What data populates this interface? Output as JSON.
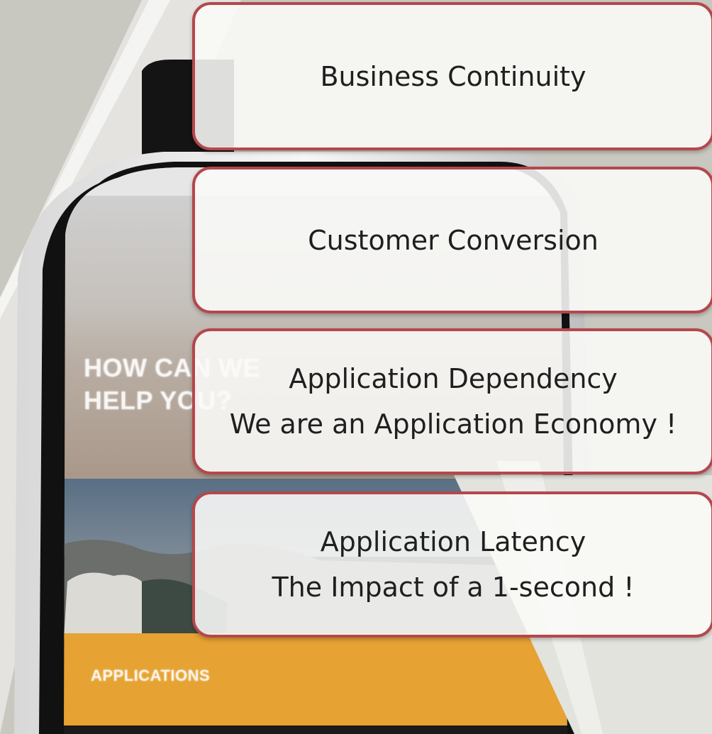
{
  "phone": {
    "headline": "HOW CAN WE\nHELP YOU?",
    "section_label": "APPLICATIONS"
  },
  "callouts": [
    {
      "line1": "Business Continuity",
      "line2": ""
    },
    {
      "line1": "Customer Conversion",
      "line2": ""
    },
    {
      "line1": "Application Dependency",
      "line2": "We are an Application Economy !"
    },
    {
      "line1": "Application Latency",
      "line2": "The Impact of a 1-second !"
    }
  ],
  "colors": {
    "background": "#c9c8c0",
    "callout_border": "#b5474c",
    "callout_fill": "#fafaf8",
    "phone_orange": "#e6a232",
    "phone_frame": "#111111"
  }
}
